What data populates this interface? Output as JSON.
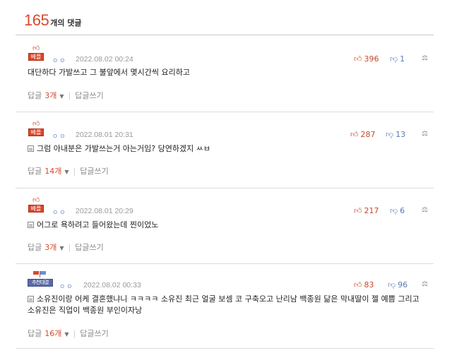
{
  "header": {
    "count": "165",
    "label": "개의 댓글"
  },
  "comments": [
    {
      "badge": "베플",
      "nick": "ㅇㅇ",
      "date": "2022.08.02 00:24",
      "up": "396",
      "down": "1",
      "memo": "",
      "text": "대단하다 가발쓰고 그 불앞에서 몇시간씩 요리하고",
      "reply_label": "답글",
      "reply_count": "3개",
      "write_label": "답글쓰기"
    },
    {
      "badge": "베플",
      "nick": "ㅇㅇ",
      "date": "2022.08.01 20:31",
      "up": "287",
      "down": "13",
      "memo": "yes",
      "text": "그럼 아내분은 가발쓰는거 아는거임? 당연하겠지 ㅆㅂ",
      "reply_label": "답글",
      "reply_count": "14개",
      "write_label": "답글쓰기"
    },
    {
      "badge": "베플",
      "nick": "ㅇㅇ",
      "date": "2022.08.01 20:29",
      "up": "217",
      "down": "6",
      "memo": "yes",
      "text": "어그로 욕하려고 들어왔는데 찐이었노",
      "reply_label": "답글",
      "reply_count": "3개",
      "write_label": "답글쓰기"
    },
    {
      "badge": "추천대결",
      "nick": "ㅇㅇ",
      "date": "2022.08.02 00:33",
      "up": "83",
      "down": "96",
      "memo": "yes",
      "text": "소유진이랑 어케 결혼했냐니 ㅋㅋㅋㅋ 소유진 최근 얼굴 보셈 코 구축오고 난리남 백종원 닮은 막내딸이 젤 예쁨 그리고 소유진은 직업이 백종원 부인이자낭",
      "reply_label": "답글",
      "reply_count": "16개",
      "write_label": "답글쓰기"
    }
  ],
  "icons": {
    "up": "thumbs-up-icon",
    "down": "thumbs-down-icon",
    "report": "report-icon",
    "memo": "memo-icon"
  },
  "colors": {
    "accent": "#d9482b",
    "best_badge": "#d9482b",
    "rank_badge": "#5a6aa8"
  }
}
